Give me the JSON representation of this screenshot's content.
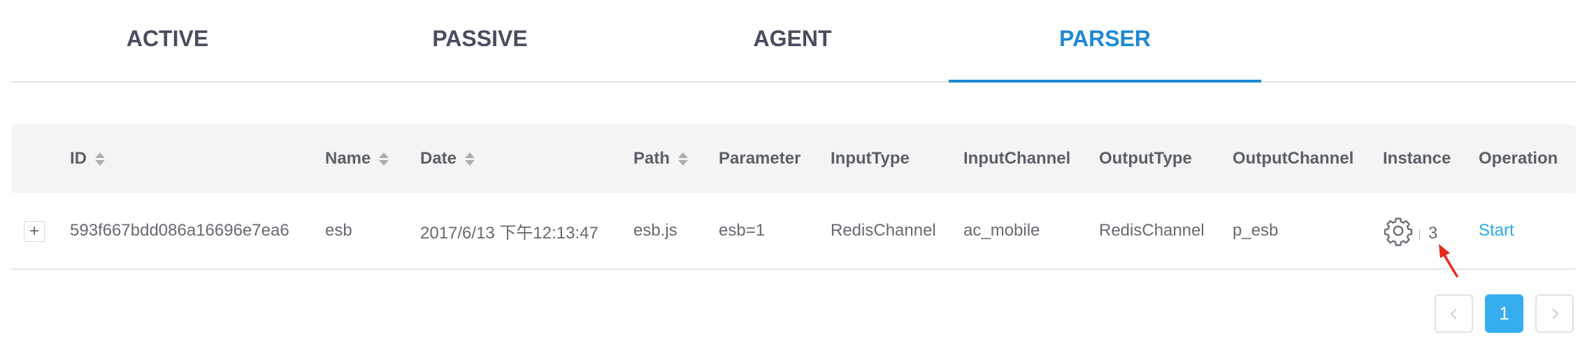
{
  "tabs": [
    {
      "label": "ACTIVE"
    },
    {
      "label": "PASSIVE"
    },
    {
      "label": "AGENT"
    },
    {
      "label": "PARSER",
      "active": true
    }
  ],
  "table": {
    "columns": {
      "id": "ID",
      "name": "Name",
      "date": "Date",
      "path": "Path",
      "parameter": "Parameter",
      "input_type": "InputType",
      "input_channel": "InputChannel",
      "output_type": "OutputType",
      "output_channel": "OutputChannel",
      "instance": "Instance",
      "operation": "Operation"
    },
    "rows": [
      {
        "expand": "+",
        "id": "593f667bdd086a16696e7ea6",
        "name": "esb",
        "date": "2017/6/13 下午12:13:47",
        "path": "esb.js",
        "parameter": "esb=1",
        "input_type": "RedisChannel",
        "input_channel": "ac_mobile",
        "output_type": "RedisChannel",
        "output_channel": "p_esb",
        "instance_icon": "gear-icon",
        "instance_count": "3",
        "operation": "Start"
      }
    ]
  },
  "pagination": {
    "prev_icon": "chevron-left-icon",
    "current_page": "1",
    "next_icon": "chevron-right-icon"
  },
  "colors": {
    "accent": "#1e88d3",
    "link": "#2aaae6",
    "page_active": "#35aef0",
    "annotation_arrow": "#e8291c"
  }
}
